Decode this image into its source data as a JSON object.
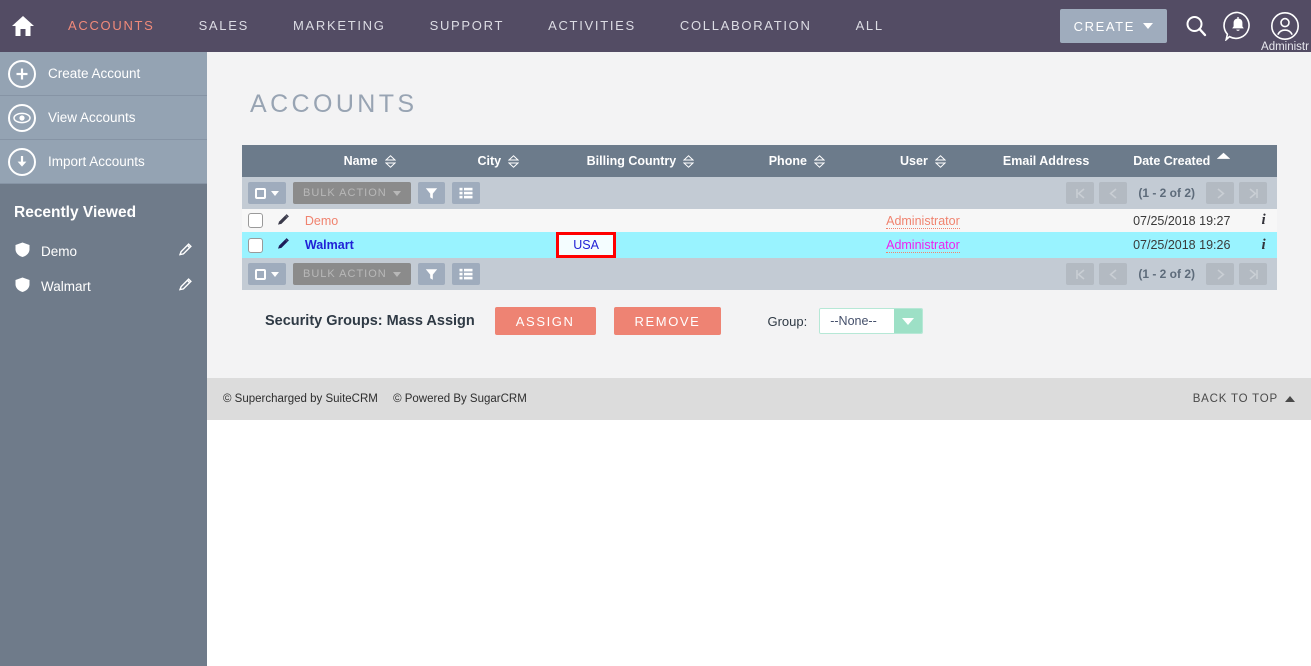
{
  "navbar": {
    "home_icon": "home-icon",
    "items": [
      {
        "label": "ACCOUNTS",
        "active": true
      },
      {
        "label": "SALES",
        "active": false
      },
      {
        "label": "MARKETING",
        "active": false
      },
      {
        "label": "SUPPORT",
        "active": false
      },
      {
        "label": "ACTIVITIES",
        "active": false
      },
      {
        "label": "COLLABORATION",
        "active": false
      },
      {
        "label": "ALL",
        "active": false
      }
    ],
    "create_label": "CREATE",
    "search_icon": "search-icon",
    "notifications_icon": "bell-notification-icon",
    "user_icon": "user-avatar-icon",
    "user_name": "Administr",
    "accent_active": "#f08a7a",
    "bg": "#534c64"
  },
  "sidebar": {
    "actions": [
      {
        "label": "Create Account",
        "icon": "plus-circle-icon"
      },
      {
        "label": "View Accounts",
        "icon": "eye-circle-icon"
      },
      {
        "label": "Import Accounts",
        "icon": "download-circle-icon"
      }
    ],
    "recent_title": "Recently Viewed",
    "recent_items": [
      {
        "label": "Demo",
        "icon": "shield-icon",
        "edit_icon": "pencil-icon"
      },
      {
        "label": "Walmart",
        "icon": "shield-icon",
        "edit_icon": "pencil-icon"
      }
    ],
    "collapse_icon": "collapse-left-icon"
  },
  "main": {
    "title": "ACCOUNTS",
    "columns": [
      {
        "label": "Name",
        "sort_icon": "sort-diamond-icon",
        "sorted": false
      },
      {
        "label": "City",
        "sort_icon": "sort-diamond-icon",
        "sorted": false
      },
      {
        "label": "Billing Country",
        "sort_icon": "sort-diamond-icon",
        "sorted": false
      },
      {
        "label": "Phone",
        "sort_icon": "sort-diamond-icon",
        "sorted": false
      },
      {
        "label": "User",
        "sort_icon": "sort-diamond-icon",
        "sorted": false
      },
      {
        "label": "Email Address",
        "sort_icon": "",
        "sorted": false
      },
      {
        "label": "Date Created",
        "sort_icon": "sort-active-icon",
        "sorted": true
      }
    ],
    "toolbar": {
      "select_all_icon": "checkbox-dropdown-icon",
      "bulk_action_label": "BULK ACTION",
      "filter_icon": "funnel-icon",
      "columns_icon": "column-chooser-icon"
    },
    "pagination": {
      "first_icon": "first-page-icon",
      "prev_icon": "prev-page-icon",
      "count_label": "(1 - 2 of 2)",
      "next_icon": "next-page-icon",
      "last_icon": "last-page-icon"
    },
    "rows": [
      {
        "selected": false,
        "name": "Demo",
        "city": "",
        "billing_country": "",
        "billing_country_highlighted": false,
        "phone": "",
        "user": "Administrator",
        "email": "",
        "date_created": "07/25/2018 19:27",
        "info_icon": "info-icon",
        "edit_icon": "pencil-icon"
      },
      {
        "selected": true,
        "name": "Walmart",
        "city": "",
        "billing_country": "USA",
        "billing_country_highlighted": true,
        "phone": "",
        "user": "Administrator",
        "email": "",
        "date_created": "07/25/2018 19:26",
        "info_icon": "info-icon",
        "edit_icon": "pencil-icon"
      }
    ],
    "security_groups": {
      "label": "Security Groups: Mass Assign",
      "assign_label": "ASSIGN",
      "remove_label": "REMOVE",
      "group_label": "Group:",
      "group_value": "--None--",
      "dropdown_icon": "chevron-down-icon",
      "button_color": "#ee8373"
    }
  },
  "footer": {
    "credit_suitecrm": "© Supercharged by SuiteCRM",
    "credit_sugarcrm": "© Powered By SugarCRM",
    "back_to_top": "BACK TO TOP",
    "back_to_top_icon": "arrow-up-icon"
  },
  "annotation": {
    "highlight_color": "#ff0000",
    "highlight_target": "USA"
  }
}
